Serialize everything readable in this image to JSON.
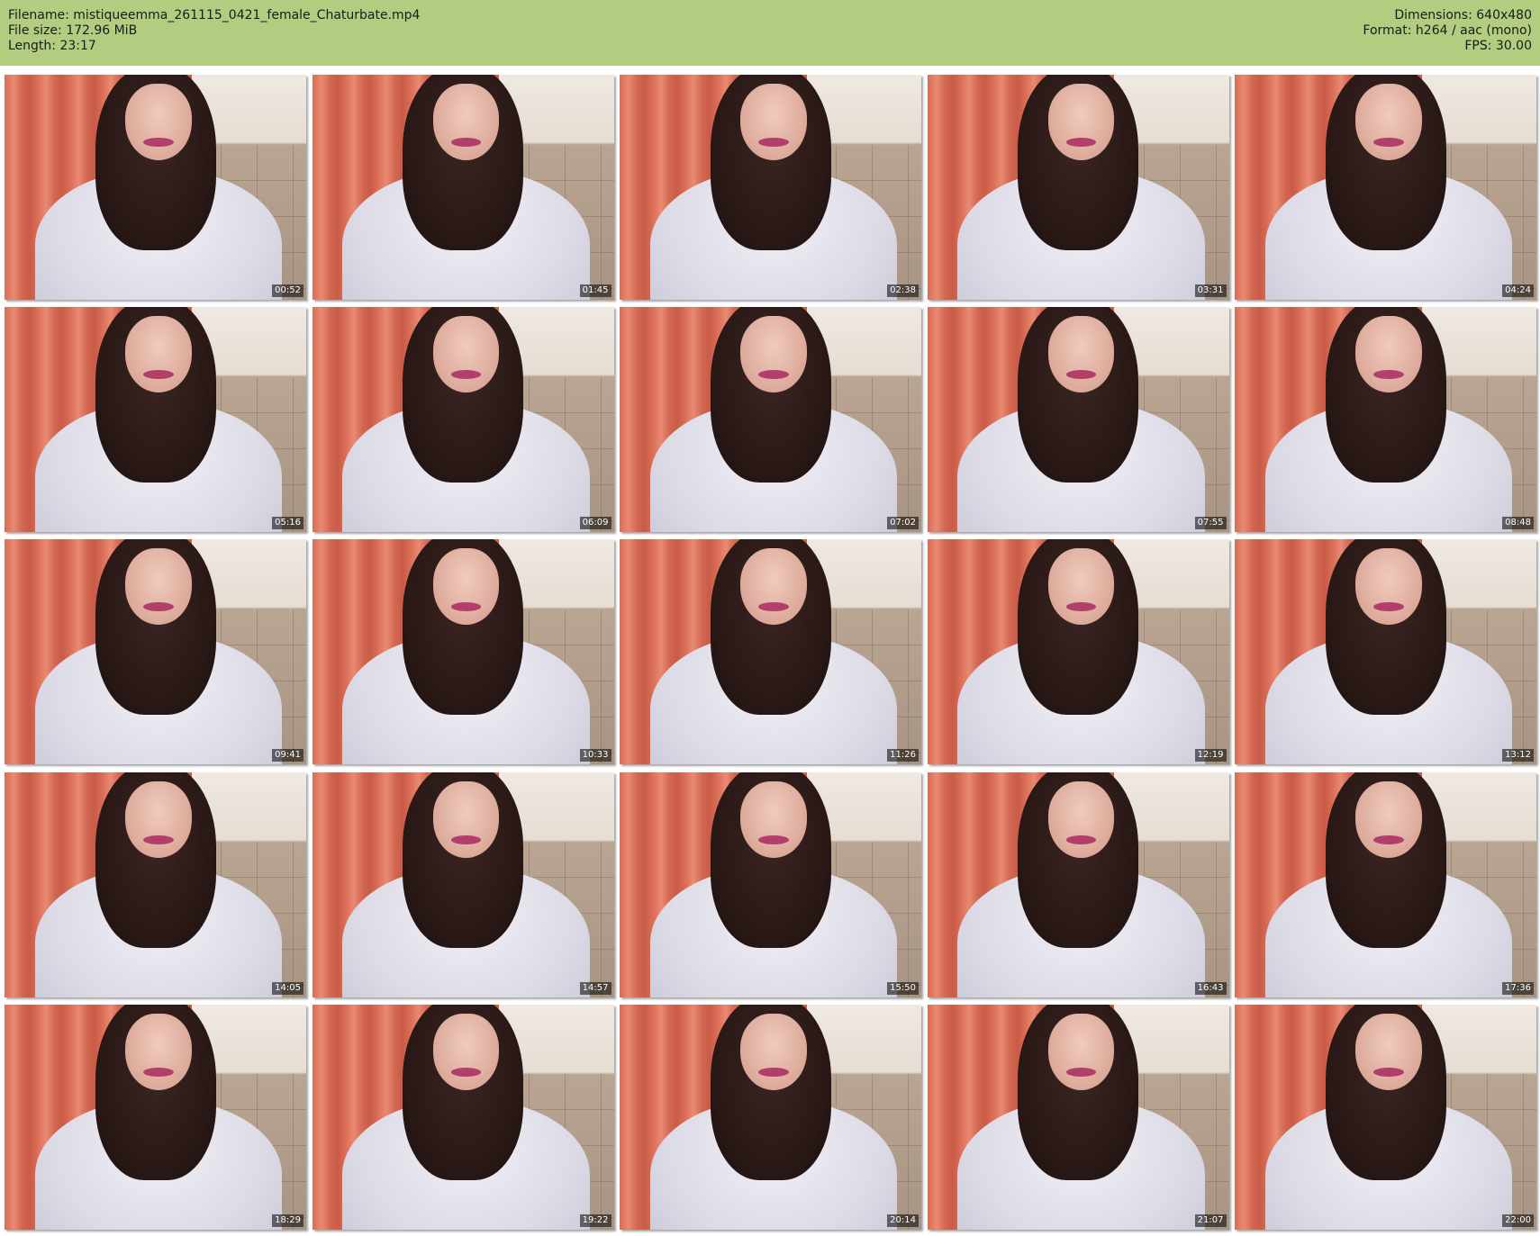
{
  "header": {
    "filename": "Filename: mistiqueemma_261115_0421_female_Chaturbate.mp4",
    "filesize": "File size: 172.96 MiB",
    "length": "Length: 23:17",
    "dimensions": "Dimensions: 640x480",
    "format": "Format: h264 / aac (mono)",
    "fps": "FPS: 30.00"
  },
  "colors": {
    "header_bg": "#b2cc80",
    "page_bg": "#ffffff",
    "curtain": "#d96c55"
  },
  "thumbnails": [
    {
      "timecode": "00:52"
    },
    {
      "timecode": "01:45"
    },
    {
      "timecode": "02:38"
    },
    {
      "timecode": "03:31"
    },
    {
      "timecode": "04:24"
    },
    {
      "timecode": "05:16"
    },
    {
      "timecode": "06:09"
    },
    {
      "timecode": "07:02"
    },
    {
      "timecode": "07:55"
    },
    {
      "timecode": "08:48"
    },
    {
      "timecode": "09:41"
    },
    {
      "timecode": "10:33"
    },
    {
      "timecode": "11:26"
    },
    {
      "timecode": "12:19"
    },
    {
      "timecode": "13:12"
    },
    {
      "timecode": "14:05"
    },
    {
      "timecode": "14:57"
    },
    {
      "timecode": "15:50"
    },
    {
      "timecode": "16:43"
    },
    {
      "timecode": "17:36"
    },
    {
      "timecode": "18:29"
    },
    {
      "timecode": "19:22"
    },
    {
      "timecode": "20:14"
    },
    {
      "timecode": "21:07"
    },
    {
      "timecode": "22:00"
    }
  ]
}
